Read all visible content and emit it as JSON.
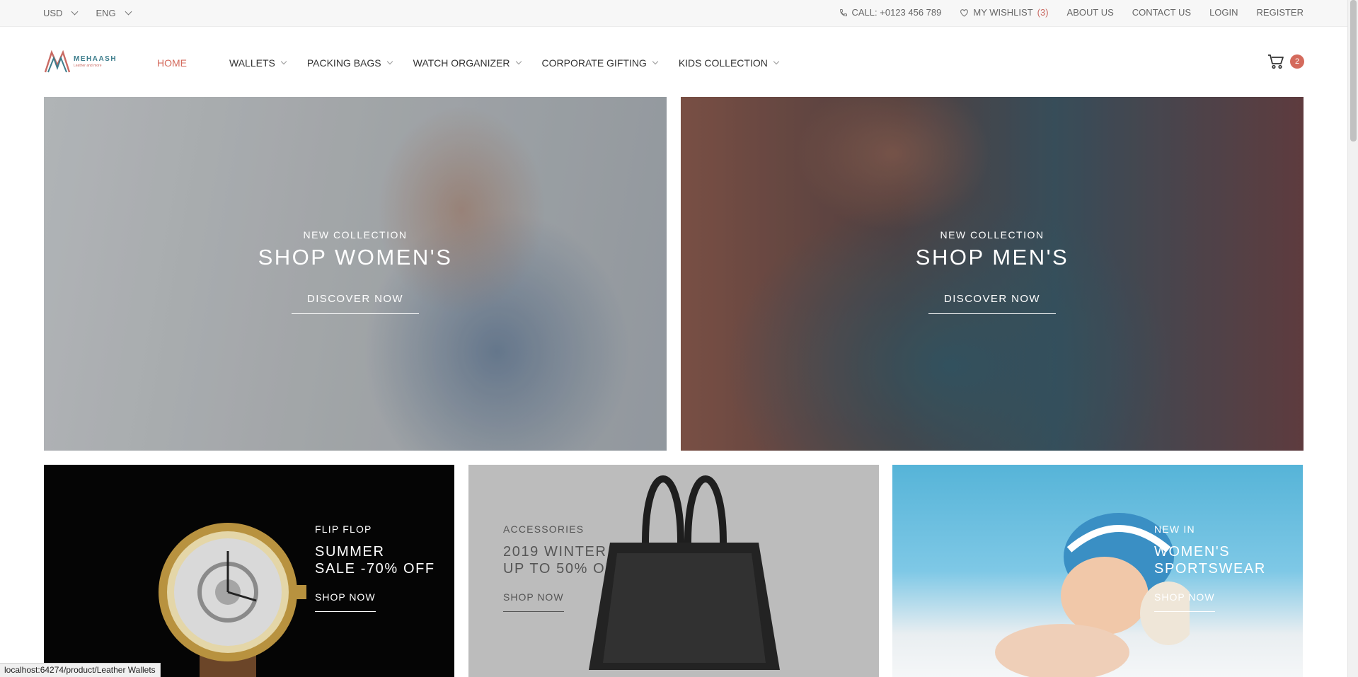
{
  "topbar": {
    "currency": "USD",
    "language": "ENG",
    "call": "CALL: +0123 456 789",
    "wishlist_label": "MY WISHLIST",
    "wishlist_count": "(3)",
    "about": "ABOUT US",
    "contact": "CONTACT US",
    "login": "LOGIN",
    "register": "REGISTER"
  },
  "header": {
    "logo_name": "MEHAASH",
    "logo_tagline": "Leather and more",
    "nav": [
      {
        "label": "HOME"
      },
      {
        "label": "WALLETS"
      },
      {
        "label": "PACKING BAGS"
      },
      {
        "label": "WATCH ORGANIZER"
      },
      {
        "label": "CORPORATE GIFTING"
      },
      {
        "label": "KIDS COLLECTION"
      }
    ],
    "cart_count": "2"
  },
  "banners": [
    {
      "subtitle": "NEW COLLECTION",
      "title": "SHOP WOMEN'S",
      "button": "DISCOVER NOW"
    },
    {
      "subtitle": "NEW COLLECTION",
      "title": "SHOP MEN'S",
      "button": "DISCOVER NOW"
    }
  ],
  "tiles": [
    {
      "subtitle": "FLIP FLOP",
      "title": "SUMMER\nSALE -70% OFF",
      "button": "SHOP NOW"
    },
    {
      "subtitle": "ACCESSORIES",
      "title": "2019 WINTER\nUP TO 50% OFF",
      "button": "SHOP NOW"
    },
    {
      "subtitle": "NEW IN",
      "title": "WOMEN'S\nSPORTSWEAR",
      "button": "SHOP NOW"
    }
  ],
  "status_url": "localhost:64274/product/Leather Wallets",
  "colors": {
    "accent": "#d46a5c",
    "logo_teal": "#3d7d8c",
    "topbar_bg": "#f7f7f7"
  }
}
